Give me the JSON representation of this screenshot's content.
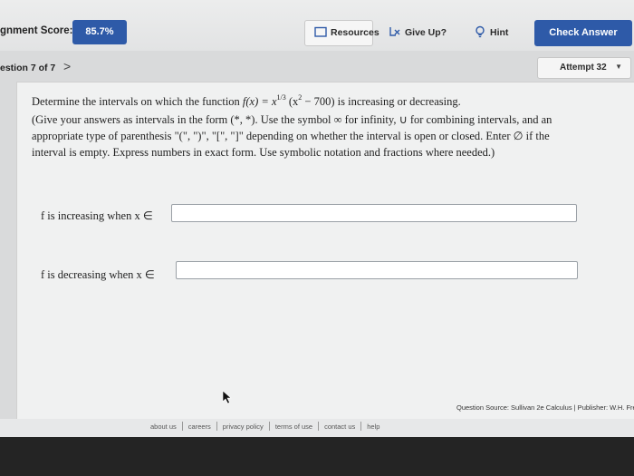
{
  "toolbar": {
    "score_label": "gnment Score:",
    "score_value": "85.7%",
    "resources": "Resources",
    "give_up": "Give Up?",
    "hint": "Hint",
    "check_answer": "Check Answer"
  },
  "nav": {
    "question_label": "estion 7 of 7",
    "next": ">",
    "attempt": "Attempt 32",
    "attempt_caret": "▼"
  },
  "question": {
    "line1_a": "Determine the intervals on which the function ",
    "fx": "f(x) = x",
    "exp1": "1/3",
    "paren": " (x",
    "exp2": "2",
    "tail": " − 700)",
    "line1_b": "  is increasing or decreasing.",
    "instructions": "(Give your answers as intervals in the form (*, *). Use the symbol ∞ for infinity, ∪ for combining intervals, and an appropriate type of parenthesis \"(\", \")\", \"[\", \"]\" depending on whether the interval is open or closed. Enter ∅ if the interval is empty. Express numbers in exact form. Use symbolic notation and fractions where needed.)",
    "increasing_label": "f is increasing when x ∈",
    "increasing_value": "",
    "decreasing_label": "f is decreasing when x ∈",
    "decreasing_value": "",
    "source": "Question Source: Sullivan 2e Calculus  |  Publisher: W.H. Fre"
  },
  "footer": {
    "links": [
      "about us",
      "careers",
      "privacy policy",
      "terms of use",
      "contact us",
      "help"
    ]
  }
}
